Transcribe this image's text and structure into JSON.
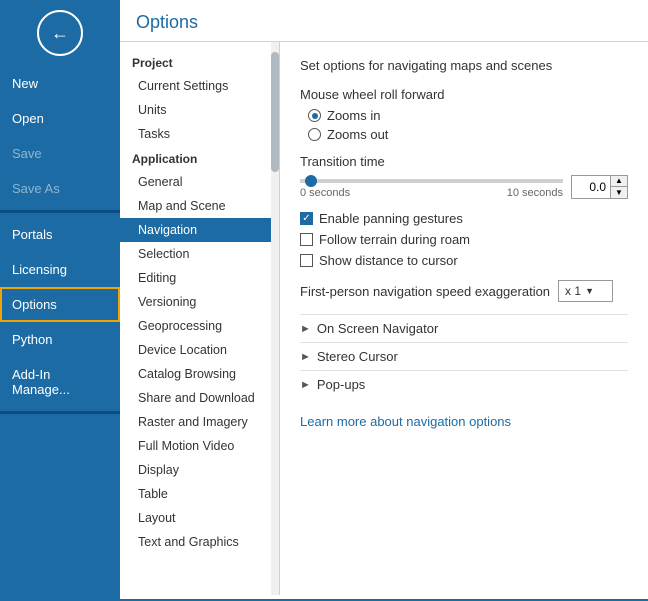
{
  "sidebar": {
    "items": [
      {
        "id": "new",
        "label": "New",
        "state": "normal"
      },
      {
        "id": "open",
        "label": "Open",
        "state": "normal"
      },
      {
        "id": "save",
        "label": "Save",
        "state": "disabled"
      },
      {
        "id": "save-as",
        "label": "Save As",
        "state": "disabled"
      },
      {
        "id": "portals",
        "label": "Portals",
        "state": "normal"
      },
      {
        "id": "licensing",
        "label": "Licensing",
        "state": "normal"
      },
      {
        "id": "options",
        "label": "Options",
        "state": "active"
      },
      {
        "id": "python",
        "label": "Python",
        "state": "normal"
      },
      {
        "id": "add-in-manager",
        "label": "Add-In Manage...",
        "state": "normal"
      }
    ]
  },
  "options_header": "Options",
  "nav": {
    "project_label": "Project",
    "project_items": [
      {
        "id": "current-settings",
        "label": "Current Settings"
      },
      {
        "id": "units",
        "label": "Units"
      },
      {
        "id": "tasks",
        "label": "Tasks"
      }
    ],
    "application_label": "Application",
    "application_items": [
      {
        "id": "general",
        "label": "General"
      },
      {
        "id": "map-and-scene",
        "label": "Map and Scene"
      },
      {
        "id": "navigation",
        "label": "Navigation",
        "active": true
      },
      {
        "id": "selection",
        "label": "Selection"
      },
      {
        "id": "editing",
        "label": "Editing"
      },
      {
        "id": "versioning",
        "label": "Versioning"
      },
      {
        "id": "geoprocessing",
        "label": "Geoprocessing"
      },
      {
        "id": "device-location",
        "label": "Device Location"
      },
      {
        "id": "catalog-browsing",
        "label": "Catalog Browsing"
      },
      {
        "id": "share-and-download",
        "label": "Share and Download"
      },
      {
        "id": "raster-and-imagery",
        "label": "Raster and Imagery"
      },
      {
        "id": "full-motion-video",
        "label": "Full Motion Video"
      },
      {
        "id": "display",
        "label": "Display"
      },
      {
        "id": "table",
        "label": "Table"
      },
      {
        "id": "layout",
        "label": "Layout"
      },
      {
        "id": "text-and-graphics",
        "label": "Text and Graphics"
      }
    ]
  },
  "settings": {
    "description": "Set options for navigating maps and scenes",
    "mouse_wheel_label": "Mouse wheel roll forward",
    "radio_zoom_in": "Zooms in",
    "radio_zoom_out": "Zooms out",
    "transition_time_label": "Transition time",
    "slider_min_label": "0 seconds",
    "slider_max_label": "10 seconds",
    "slider_value": "0.0",
    "enable_panning_label": "Enable panning gestures",
    "follow_terrain_label": "Follow terrain during roam",
    "show_distance_label": "Show distance to cursor",
    "first_person_label": "First-person navigation speed exaggeration",
    "first_person_value": "x 1",
    "expandable_items": [
      {
        "id": "on-screen-navigator",
        "label": "On Screen Navigator"
      },
      {
        "id": "stereo-cursor",
        "label": "Stereo Cursor"
      },
      {
        "id": "pop-ups",
        "label": "Pop-ups"
      }
    ],
    "learn_more_text": "Learn more about navigation options"
  }
}
